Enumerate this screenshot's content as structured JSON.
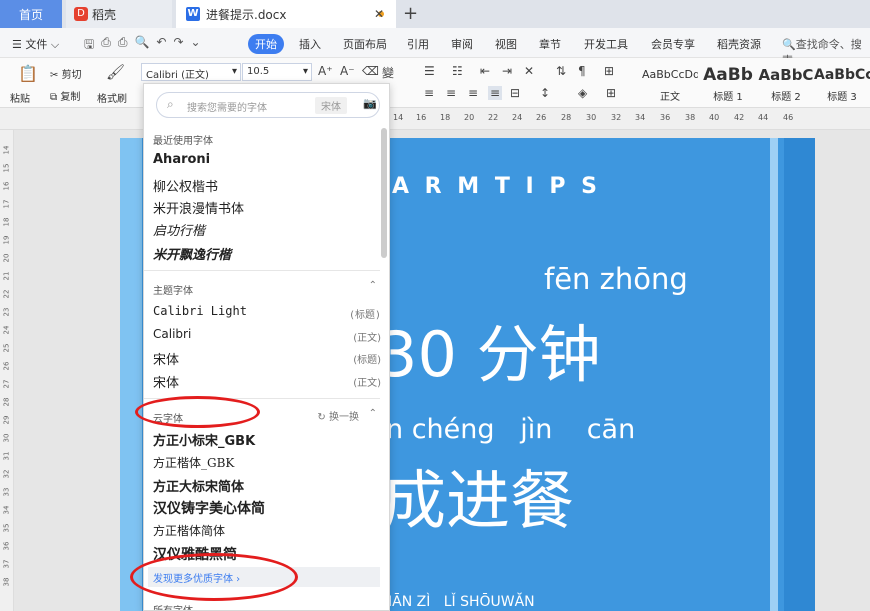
{
  "tabs": {
    "home": "首页",
    "daoke": "稻壳",
    "doc": "进餐提示.docx"
  },
  "menu": {
    "file": "文件",
    "items": [
      "开始",
      "插入",
      "页面布局",
      "引用",
      "审阅",
      "视图",
      "章节",
      "开发工具",
      "会员专享",
      "稻壳资源"
    ],
    "search": "查找命令、搜索"
  },
  "ribbon": {
    "paste": "粘贴",
    "cut": "剪切",
    "copy": "复制",
    "format_painter": "格式刷",
    "font_name": "Calibri (正文)",
    "font_size": "10.5",
    "styles": [
      {
        "sample": "AaBbCcDd",
        "label": "正文"
      },
      {
        "sample": "AaBb",
        "label": "标题 1"
      },
      {
        "sample": "AaBbC",
        "label": "标题 2"
      },
      {
        "sample": "AaBbCc",
        "label": "标题 3"
      }
    ]
  },
  "ruler": {
    "h_ticks": [
      "14",
      "16",
      "18",
      "20",
      "22",
      "24",
      "26",
      "28",
      "30",
      "32",
      "34",
      "36",
      "38",
      "40",
      "42",
      "44",
      "46"
    ],
    "v_ticks": [
      "14",
      "15",
      "16",
      "17",
      "18",
      "19",
      "20",
      "21",
      "22",
      "23",
      "24",
      "25",
      "26",
      "27",
      "28",
      "29",
      "30",
      "31",
      "32",
      "33",
      "34",
      "35",
      "36",
      "37",
      "38"
    ]
  },
  "document": {
    "heading": "A R M   T I P S",
    "pinyin1": "fēn zhōng",
    "line1": "30 分钟",
    "pinyin2": "n chéng   jìn    cān",
    "line2": "成进餐",
    "bottom": "IĀN ZÌ   LǏ SHŌUWĂN"
  },
  "dropdown": {
    "search_placeholder": "搜索您需要的字体",
    "search_tag": "宋体",
    "recent_title": "最近使用字体",
    "recent": [
      "Aharoni",
      "柳公权楷书",
      "米开浪漫情书体",
      "启功行楷",
      "米开飘逸行楷"
    ],
    "theme_title": "主题字体",
    "theme": [
      {
        "name": "Calibri Light",
        "hint": "(标题)"
      },
      {
        "name": "Calibri",
        "hint": "(正文)"
      },
      {
        "name": "宋体",
        "hint": "(标题)"
      },
      {
        "name": "宋体",
        "hint": "(正文)"
      }
    ],
    "cloud_title": "云字体",
    "cloud_refresh": "换一换",
    "cloud": [
      "方正小标宋_GBK",
      "方正楷体_GBK",
      "方正大标宋简体",
      "汉仪铸字美心体简",
      "方正楷体简体",
      "汉仪雅酷黑简"
    ],
    "more_link": "发现更多优质字体 ›",
    "all_title": "所有字体"
  },
  "colors": {
    "accent": "#3d7df0",
    "page_blue": "#3e97df",
    "annotation_red": "#e31d1d"
  }
}
